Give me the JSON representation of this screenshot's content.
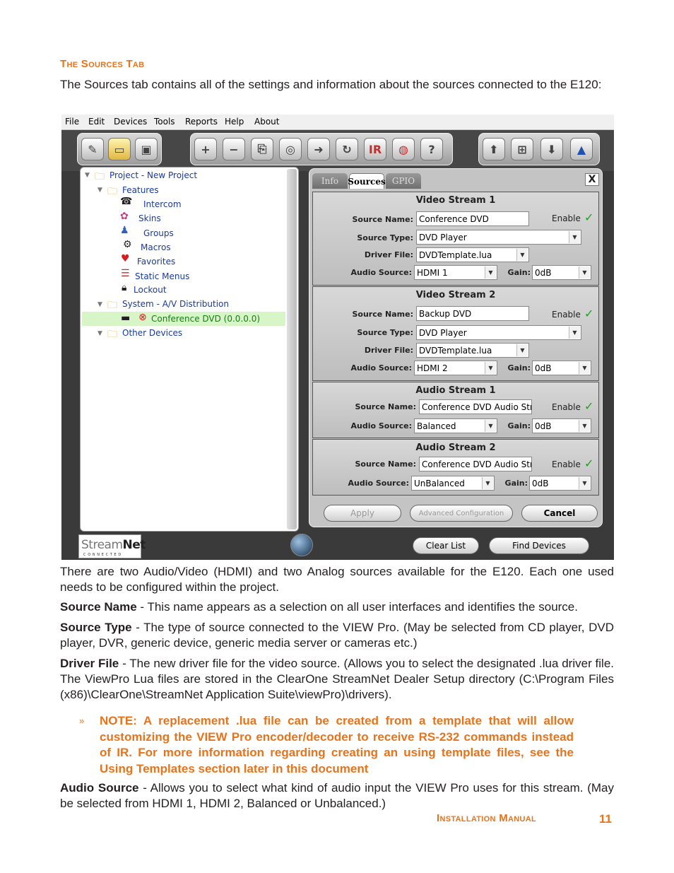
{
  "section_title": "The Sources Tab",
  "intro": "The Sources tab contains all of the settings and information about the sources connected to the E120:",
  "app": {
    "menu": [
      "File",
      "Edit",
      "Devices",
      "Tools",
      "Reports",
      "Help",
      "About"
    ],
    "tree": {
      "project": "Project - New Project",
      "features": "Features",
      "intercom": "Intercom",
      "skins": "Skins",
      "groups": "Groups",
      "macros": "Macros",
      "favorites": "Favorites",
      "static_menus": "Static Menus",
      "lockout": "Lockout",
      "system": "System - A/V Distribution",
      "conference_dvd": "Conference DVD (0.0.0.0)",
      "other_devices": "Other Devices"
    },
    "tabs": [
      "Info",
      "Sources",
      "GPIO"
    ],
    "close": "X",
    "labels": {
      "source_name": "Source Name:",
      "source_type": "Source Type:",
      "driver_file": "Driver File:",
      "audio_source": "Audio Source:",
      "gain": "Gain:",
      "enable": "Enable"
    },
    "video_stream_1": {
      "title": "Video Stream 1",
      "source_name": "Conference DVD",
      "source_type": "DVD Player",
      "driver_file": "DVDTemplate.lua",
      "audio_source": "HDMI 1",
      "gain": "0dB"
    },
    "video_stream_2": {
      "title": "Video Stream 2",
      "source_name": "Backup DVD",
      "source_type": "DVD Player",
      "driver_file": "DVDTemplate.lua",
      "audio_source": "HDMI 2",
      "gain": "0dB"
    },
    "audio_stream_1": {
      "title": "Audio Stream 1",
      "source_name": "Conference DVD Audio Stre",
      "audio_source": "Balanced",
      "gain": "0dB"
    },
    "audio_stream_2": {
      "title": "Audio Stream 2",
      "source_name": "Conference DVD Audio Stre",
      "audio_source": "UnBalanced",
      "gain": "0dB"
    },
    "buttons": {
      "apply": "Apply",
      "advanced": "Advanced Configuration",
      "cancel": "Cancel",
      "clear_list": "Clear List",
      "find_devices": "Find Devices"
    },
    "logo": {
      "main_a": "Stream",
      "main_b": "Net",
      "sub": "CONNECTED"
    }
  },
  "para_two_sources": "There are two Audio/Video (HDMI) and two Analog sources available for the E120. Each one used needs to be configured within the project.",
  "source_name_term": "Source Name",
  "source_name_desc": " - This name appears as a selection on all user interfaces and identifies the source.",
  "source_type_term": "Source Type",
  "source_type_desc": " - The type of source connected to the VIEW Pro. (May be selected from CD player, DVD player, DVR, generic device, generic media server or cameras etc.)",
  "driver_file_term": "Driver File",
  "driver_file_desc": " - The new driver file for the video source. (Allows you to select the designated .lua driver file. The ViewPro Lua files are stored in the ClearOne StreamNet Dealer Setup directory (C:\\Program Files (x86)\\ClearOne\\StreamNet Application Suite\\viewPro)\\drivers).",
  "note_bullet": "»",
  "note": "NOTE: A replacement .lua file can be created from a template that will allow customizing the VIEW Pro encoder/decoder to receive RS-232 commands instead of IR. For more information regarding creating an using template files, see the Using Templates section later in this document",
  "audio_source_term": "Audio Source",
  "audio_source_desc": " - Allows you to select what kind of audio input the VIEW Pro uses for this stream. (May be selected from HDMI 1, HDMI 2, Balanced or Unbalanced.)",
  "footer_label": "Installation Manual",
  "page_number": "11"
}
